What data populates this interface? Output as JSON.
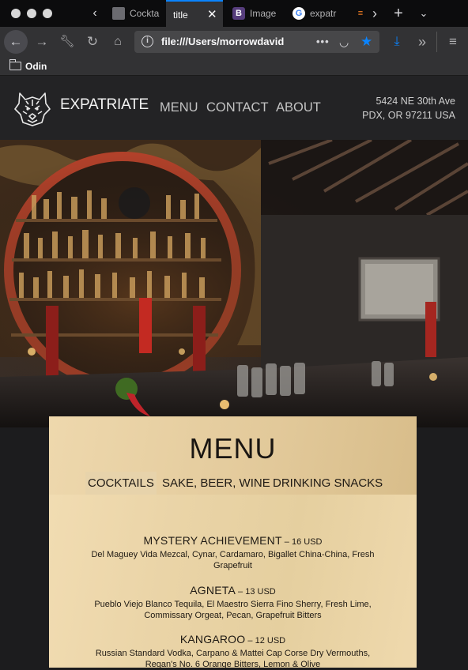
{
  "browser": {
    "tabs": [
      {
        "label": "Cockta",
        "icon": "cube-icon"
      },
      {
        "label": "title",
        "icon": "",
        "active": true
      },
      {
        "label": "Image",
        "icon": "bootstrap-icon",
        "icon_text": "B"
      },
      {
        "label": "expatr",
        "icon": "google-icon",
        "icon_text": "G"
      }
    ],
    "url": "file:///Users/morrowdavid",
    "bookmark": "Odin",
    "colors": {
      "accent": "#0a84ff"
    }
  },
  "site": {
    "brand": "EXPATRIATE",
    "nav": [
      "MENU",
      "CONTACT",
      "ABOUT"
    ],
    "address_line1": "5424 NE 30th Ave",
    "address_line2": "PDX, OR 97211 USA"
  },
  "menu": {
    "title": "MENU",
    "tabs": [
      "COCKTAILS",
      "SAKE, BEER, WINE",
      "DRINKING SNACKS"
    ],
    "active_tab": "COCKTAILS",
    "items": [
      {
        "name": "MYSTERY ACHIEVEMENT",
        "sep": " – ",
        "price": "16 USD",
        "desc": "Del Maguey Vida Mezcal, Cynar, Cardamaro, Bigallet China-China, Fresh Grapefruit"
      },
      {
        "name": "AGNETA",
        "sep": " – ",
        "price": "13 USD",
        "desc": "Pueblo Viejo Blanco Tequila, El Maestro Sierra Fino Sherry, Fresh Lime, Commissary Orgeat, Pecan, Grapefruit Bitters"
      },
      {
        "name": "KANGAROO",
        "sep": " – ",
        "price": "12 USD",
        "desc": "Russian Standard Vodka, Carpano & Mattei Cap Corse Dry Vermouths, Regan's No. 6 Orange Bitters, Lemon & Olive"
      }
    ]
  }
}
